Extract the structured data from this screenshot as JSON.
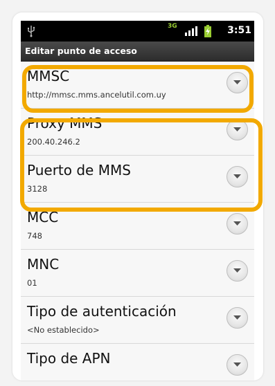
{
  "status_bar": {
    "network_type": "3G",
    "time": "3:51",
    "icons": [
      "usb-icon",
      "signal-icon",
      "battery-charging-icon"
    ]
  },
  "title_bar": {
    "title": "Editar punto de acceso"
  },
  "settings": [
    {
      "title": "MMSC",
      "summary": "http://mmsc.mms.ancelutil.com.uy"
    },
    {
      "title": "Proxy MMS",
      "summary": "200.40.246.2"
    },
    {
      "title": "Puerto de MMS",
      "summary": "3128"
    },
    {
      "title": "MCC",
      "summary": "748"
    },
    {
      "title": "MNC",
      "summary": "01"
    },
    {
      "title": "Tipo de autenticación",
      "summary": "<No establecido>"
    },
    {
      "title": "Tipo de APN",
      "summary": ""
    }
  ],
  "highlight_color": "#f2a900",
  "highlighted_items": [
    "MMSC",
    "Proxy MMS",
    "Puerto de MMS"
  ]
}
